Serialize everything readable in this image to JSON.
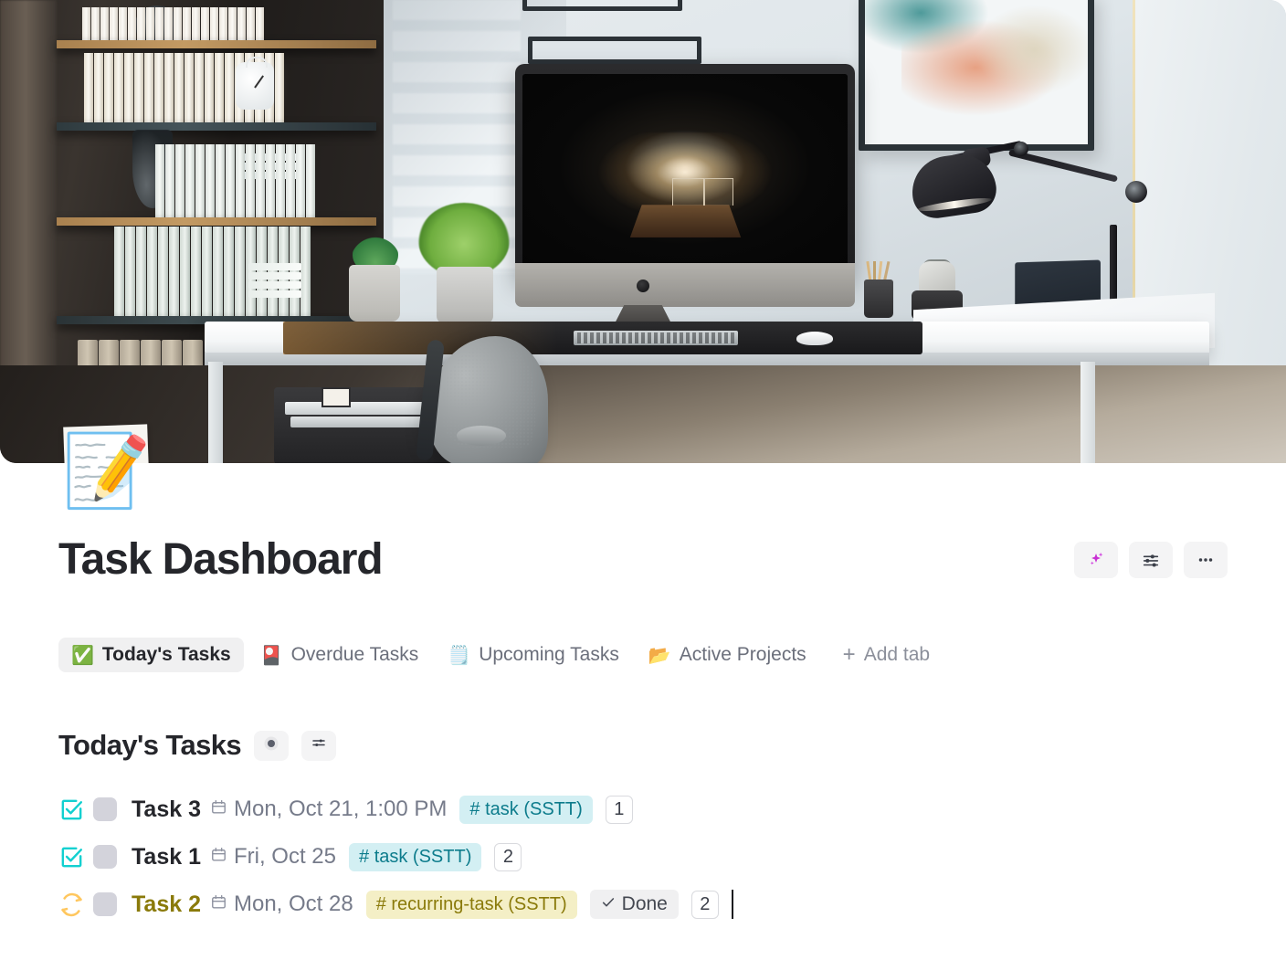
{
  "page": {
    "emoji": "📝",
    "title": "Task Dashboard"
  },
  "title_actions": [
    {
      "name": "ai-sparkle-button",
      "icon": "sparkle-icon",
      "label": ""
    },
    {
      "name": "page-settings-button",
      "icon": "sliders-icon",
      "label": ""
    },
    {
      "name": "page-more-button",
      "icon": "ellipsis-icon",
      "label": ""
    }
  ],
  "tabs": [
    {
      "emoji": "✅",
      "label": "Today's Tasks",
      "active": true
    },
    {
      "emoji": "🎴",
      "label": "Overdue Tasks",
      "active": false
    },
    {
      "emoji": "🗒️",
      "label": "Upcoming Tasks",
      "active": false
    },
    {
      "emoji": "📂",
      "label": "Active Projects",
      "active": false
    }
  ],
  "add_tab": {
    "plus": "+",
    "label": "Add tab"
  },
  "section": {
    "title": "Today's Tasks",
    "buttons": [
      {
        "name": "view-options-button",
        "icon": "circle-filled-icon"
      },
      {
        "name": "filter-button",
        "icon": "sliders-icon"
      }
    ]
  },
  "tasks": [
    {
      "status_icon": "checkbox-checked-icon",
      "status_color": "#12d0d0",
      "name": "Task 3",
      "name_style": "default",
      "date": "Mon, Oct 21, 1:00 PM",
      "tag": "# task (SSTT)",
      "tag_style": "cyan",
      "done_label": null,
      "count": "1",
      "caret": false
    },
    {
      "status_icon": "checkbox-checked-icon",
      "status_color": "#12d0d0",
      "name": "Task 1",
      "name_style": "default",
      "date": "Fri, Oct 25",
      "tag": "# task (SSTT)",
      "tag_style": "cyan",
      "done_label": null,
      "count": "2",
      "caret": false
    },
    {
      "status_icon": "recurring-refresh-icon",
      "status_color": "#ffc75f",
      "name": "Task 2",
      "name_style": "olive",
      "date": "Mon, Oct 28",
      "tag": "# recurring-task (SSTT)",
      "tag_style": "yellow",
      "done_label": "Done",
      "count": "2",
      "caret": true
    }
  ],
  "colors": {
    "accent_cyan": "#12d0d0",
    "accent_yellow": "#ffc75f",
    "tag_cyan_bg": "#d3eff3",
    "tag_cyan_fg": "#0d7c8c",
    "tag_yellow_bg": "#f4efc6",
    "tag_yellow_fg": "#8a7a0a",
    "title_color": "#25262b",
    "muted_text": "#767b8a",
    "chip_bg": "#f0f0f1"
  }
}
